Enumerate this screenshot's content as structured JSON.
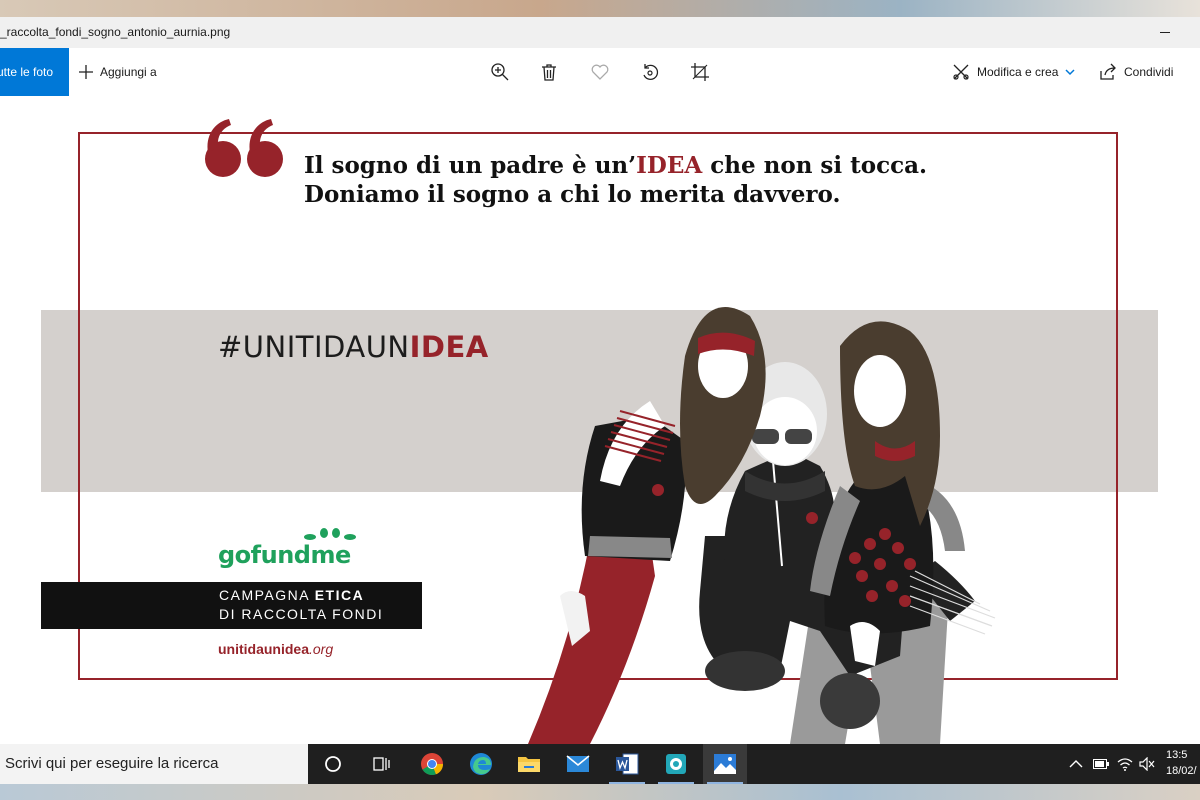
{
  "window": {
    "filename": "_raccolta_fondi_sogno_antonio_aurnia.png"
  },
  "toolbar": {
    "all_photos": "utte le foto",
    "add_to": "Aggiungi a",
    "edit_create": "Modifica e crea",
    "share": "Condividi",
    "icons": [
      "zoom-in-icon",
      "delete-icon",
      "heart-icon",
      "rotate-icon",
      "crop-icon",
      "edit-icon",
      "share-icon"
    ]
  },
  "poster": {
    "quote_line1_pre": "Il sogno di un padre è un’",
    "quote_line1_hl": "IDEA",
    "quote_line1_post": " che non si tocca.",
    "quote_line2": "Doniamo il sogno a chi lo merita davvero.",
    "hashtag_pre": "#UNITIDAUN",
    "hashtag_hl": "IDEA",
    "gofundme": "gofundme",
    "campaign_l1_pre": "CAMPAGNA ",
    "campaign_l1_bold": "ETICA",
    "campaign_l2": "DI RACCOLTA FONDI",
    "site_main": "unitidaunidea",
    "site_ext": ".org",
    "colors": {
      "accent": "#96232a",
      "band": "#d4d0cd",
      "gofundme_green": "#1fa15c"
    }
  },
  "taskbar": {
    "search_placeholder": "Scrivi qui per eseguire la ricerca",
    "apps": [
      "cortana-icon",
      "task-view-icon",
      "chrome-icon",
      "edge-icon",
      "file-explorer-icon",
      "mail-icon",
      "word-icon",
      "camera-icon",
      "photos-icon"
    ],
    "clock_time": "13:5",
    "clock_date": "18/02/"
  }
}
